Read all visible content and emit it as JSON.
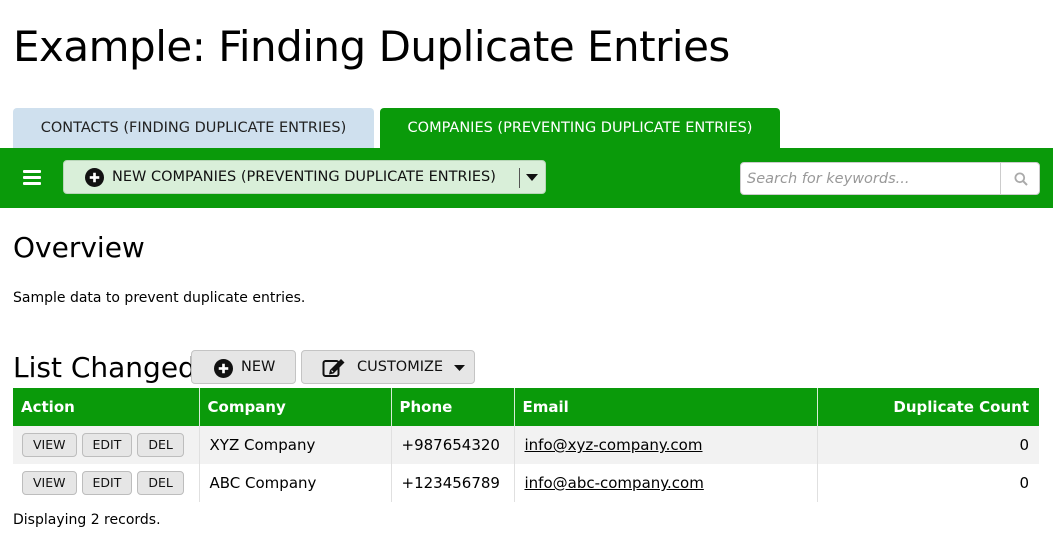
{
  "page": {
    "title": "Example: Finding Duplicate Entries"
  },
  "tabs": [
    {
      "label": "CONTACTS (FINDING DUPLICATE ENTRIES)",
      "active": false
    },
    {
      "label": "COMPANIES (PREVENTING DUPLICATE ENTRIES)",
      "active": true
    }
  ],
  "toolbar": {
    "menu_icon": "hamburger-menu-icon",
    "new_button_label": "NEW COMPANIES (PREVENTING DUPLICATE ENTRIES)",
    "search_placeholder": "Search for keywords...",
    "search_icon": "magnifier-icon",
    "bar_color": "#0a9a0a"
  },
  "overview": {
    "title": "Overview",
    "description": "Sample data to prevent duplicate entries."
  },
  "list": {
    "title": "List Changed",
    "new_label": "NEW",
    "customize_label": "CUSTOMIZE",
    "columns": [
      "Action",
      "Company",
      "Phone",
      "Email",
      "Duplicate Count"
    ],
    "row_actions": [
      "VIEW",
      "EDIT",
      "DEL"
    ],
    "rows": [
      {
        "company": "XYZ Company",
        "phone": "+987654320",
        "email": "info@xyz-company.com",
        "duplicate_count": "0"
      },
      {
        "company": "ABC Company",
        "phone": "+123456789",
        "email": "info@abc-company.com",
        "duplicate_count": "0"
      }
    ],
    "footer": "Displaying 2 records."
  }
}
